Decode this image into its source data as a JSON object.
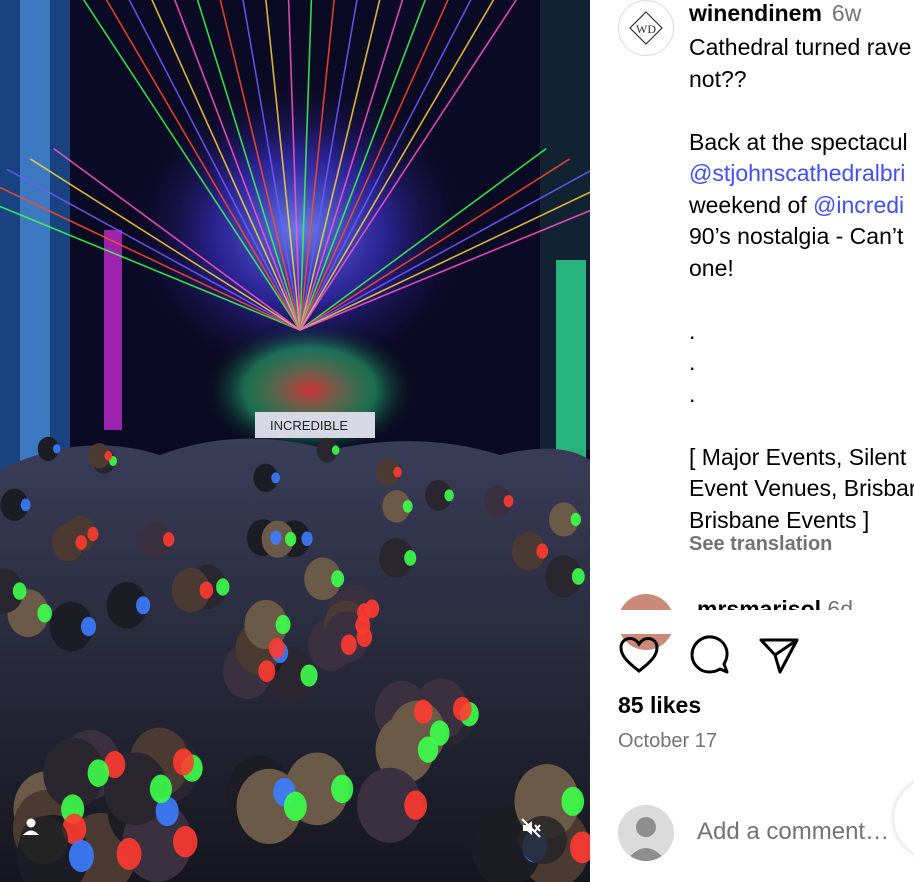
{
  "post": {
    "username": "winendinem",
    "time_ago": "6w",
    "avatar_text": "WD",
    "caption_lines": [
      {
        "text": "Cathedral turned rave",
        "mention": false
      },
      {
        "text": "not??",
        "mention": false
      },
      {
        "text": "",
        "mention": false
      },
      {
        "text": "Back at the spectacul",
        "mention": false
      },
      {
        "text": "@stjohnscathedralbri",
        "mention": true
      },
      {
        "text": "weekend of ",
        "mention": false,
        "suffix_mention": "@incredi"
      },
      {
        "text": "90’s nostalgia - Can’t",
        "mention": false
      },
      {
        "text": "one!",
        "mention": false
      },
      {
        "text": "",
        "mention": false
      },
      {
        "text": ".",
        "mention": false
      },
      {
        "text": ".",
        "mention": false
      },
      {
        "text": ".",
        "mention": false
      },
      {
        "text": "",
        "mention": false
      },
      {
        "text": "[ Major Events, Silent",
        "mention": false
      },
      {
        "text": "Event Venues, Brisbar",
        "mention": false
      },
      {
        "text": "Brisbane Events ]",
        "mention": false
      }
    ],
    "see_translation": "See translation",
    "next_comment_user": "mrsmarisol",
    "next_comment_time": "6d",
    "likes": "85 likes",
    "date": "October 17",
    "comment_placeholder": "Add a comment…",
    "media_sign_text": "INCREDIBLE"
  },
  "icons": {
    "like": "heart-icon",
    "comment": "speech-bubble-icon",
    "share": "send-icon",
    "tagged": "user-tag-icon",
    "mute": "muted-speaker-icon"
  },
  "colors": {
    "mention": "#4150f7",
    "secondary_text": "#737373",
    "laser_green": "#3cff4a",
    "laser_red": "#ff4a2a",
    "laser_blue": "#6f5bff"
  }
}
